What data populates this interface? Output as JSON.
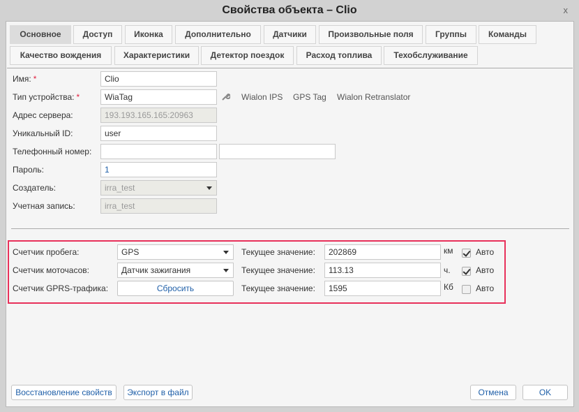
{
  "window": {
    "title": "Свойства объекта – Clio",
    "close": "x"
  },
  "tabs": {
    "row1": [
      "Основное",
      "Доступ",
      "Иконка",
      "Дополнительно",
      "Датчики",
      "Произвольные поля",
      "Группы",
      "Команды"
    ],
    "row2": [
      "Качество вождения",
      "Характеристики",
      "Детектор поездок",
      "Расход топлива",
      "Техобслуживание"
    ],
    "active": "Основное"
  },
  "form": {
    "name": {
      "label": "Имя:",
      "value": "Clio"
    },
    "device_type": {
      "label": "Тип устройства:",
      "value": "WiaTag",
      "links": [
        "Wialon IPS",
        "GPS Tag",
        "Wialon Retranslator"
      ]
    },
    "server": {
      "label": "Адрес сервера:",
      "value": "193.193.165.165:20963"
    },
    "uid": {
      "label": "Уникальный ID:",
      "value": "user"
    },
    "phone": {
      "label": "Телефонный номер:",
      "value1": "",
      "value2": ""
    },
    "password": {
      "label": "Пароль:",
      "value": "1"
    },
    "creator": {
      "label": "Создатель:",
      "value": "irra_test"
    },
    "account": {
      "label": "Учетная запись:",
      "value": "irra_test"
    },
    "required_mark": "*"
  },
  "counters": {
    "current_label": "Текущее значение:",
    "auto_label": "Авто",
    "mileage": {
      "label": "Счетчик пробега:",
      "select": "GPS",
      "value": "202869",
      "unit": "км",
      "auto": true
    },
    "engine": {
      "label": "Счетчик моточасов:",
      "select": "Датчик зажигания",
      "value": "113.13",
      "unit": "ч.",
      "auto": true
    },
    "gprs": {
      "label": "Счетчик GPRS-трафика:",
      "button": "Сбросить",
      "value": "1595",
      "unit": "Кб",
      "auto": false
    }
  },
  "footer": {
    "restore": "Восстановление свойств",
    "export": "Экспорт в файл",
    "cancel": "Отмена",
    "ok": "OK"
  }
}
